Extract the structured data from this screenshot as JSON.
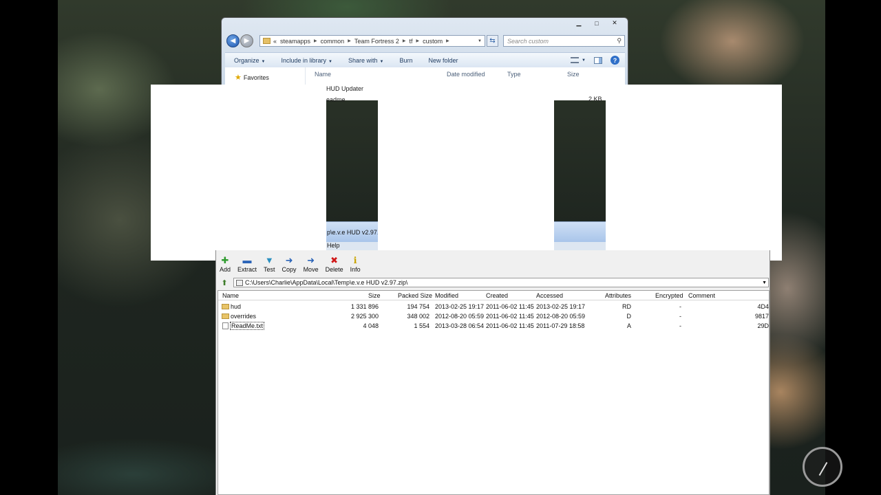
{
  "explorer": {
    "caption": {
      "minimize": "▁",
      "maximize": "□",
      "close": "✕"
    },
    "breadcrumbs": [
      "«",
      "steamapps",
      "common",
      "Team Fortress 2",
      "tf",
      "custom"
    ],
    "search_placeholder": "Search custom",
    "toolbar": [
      "Organize",
      "Include in library",
      "Share with",
      "Burn",
      "New folder"
    ],
    "favorites": "Favorites",
    "columns": [
      "Name",
      "Date modified",
      "Type",
      "Size"
    ],
    "files": [
      {
        "name": "HUD Updater",
        "size": ""
      },
      {
        "name": "eadme",
        "size": "2 KB"
      }
    ]
  },
  "zip": {
    "title_fragment": "p\\e.v.e HUD v2.97.z",
    "menu_fragment": "Help",
    "toolbar": [
      {
        "label": "Add",
        "icon": "✚",
        "color": "#2e9b2e"
      },
      {
        "label": "Extract",
        "icon": "▬",
        "color": "#2b64b8"
      },
      {
        "label": "Test",
        "icon": "▼",
        "color": "#2a8fc0"
      },
      {
        "label": "Copy",
        "icon": "➜",
        "color": "#2b64b8"
      },
      {
        "label": "Move",
        "icon": "➜",
        "color": "#2b64b8"
      },
      {
        "label": "Delete",
        "icon": "✖",
        "color": "#d01818"
      },
      {
        "label": "Info",
        "icon": "ℹ",
        "color": "#c9a400"
      }
    ],
    "path": "C:\\Users\\Charlie\\AppData\\Local\\Temp\\e.v.e HUD v2.97.zip\\",
    "columns": [
      "Name",
      "Size",
      "Packed Size",
      "Modified",
      "Created",
      "Accessed",
      "Attributes",
      "Encrypted",
      "Comment"
    ],
    "rows": [
      {
        "name": "hud",
        "size": "1 331 896",
        "packed": "194 754",
        "modified": "2013-02-25 19:17",
        "created": "2011-06-02 11:45",
        "accessed": "2013-02-25 19:17",
        "attributes": "RD",
        "encrypted": "-",
        "comment": "",
        "crc": "4D4",
        "type": "folder"
      },
      {
        "name": "overrides",
        "size": "2 925 300",
        "packed": "348 002",
        "modified": "2012-08-20 05:59",
        "created": "2011-06-02 11:45",
        "accessed": "2012-08-20 05:59",
        "attributes": "D",
        "encrypted": "-",
        "comment": "",
        "crc": "9817",
        "type": "folder"
      },
      {
        "name": "ReadMe.txt",
        "size": "4 048",
        "packed": "1 554",
        "modified": "2013-03-28 06:54",
        "created": "2011-06-02 11:45",
        "accessed": "2011-07-29 18:58",
        "attributes": "A",
        "encrypted": "-",
        "comment": "",
        "crc": "29D",
        "type": "file"
      }
    ]
  }
}
